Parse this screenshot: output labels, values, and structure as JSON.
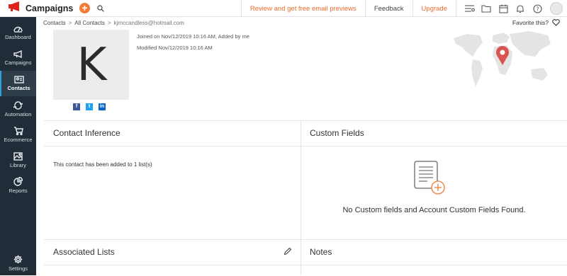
{
  "app": {
    "title": "Campaigns"
  },
  "topbar": {
    "review_link": "Review and get free email previews",
    "feedback": "Feedback",
    "upgrade": "Upgrade",
    "accent": "#ef6b2b"
  },
  "sidebar": {
    "items": [
      {
        "label": "Dashboard",
        "icon": "dashboard-icon"
      },
      {
        "label": "Campaigns",
        "icon": "megaphone-icon"
      },
      {
        "label": "Contacts",
        "icon": "contact-card-icon",
        "active": true
      },
      {
        "label": "Automation",
        "icon": "automation-icon"
      },
      {
        "label": "Ecommerce",
        "icon": "cart-icon"
      },
      {
        "label": "Library",
        "icon": "image-library-icon"
      },
      {
        "label": "Reports",
        "icon": "pie-chart-icon"
      },
      {
        "label": "Settings",
        "icon": "gear-icon"
      }
    ]
  },
  "breadcrumb": {
    "contacts": "Contacts",
    "all_contacts": "All Contacts",
    "email": "kjmccandless@hotmail.com",
    "favorite": "Favorite this?"
  },
  "contact": {
    "initial": "K",
    "joined": "Joined on Nov/12/2019 10:16 AM, Added by me",
    "modified": "Modified Nov/12/2019 10:16 AM"
  },
  "inference": {
    "title": "Contact Inference",
    "text": "This contact has been added to 1 list(s)"
  },
  "custom_fields": {
    "title": "Custom Fields",
    "empty": "No Custom fields and Account Custom Fields Found."
  },
  "associated_lists": {
    "title": "Associated Lists"
  },
  "notes": {
    "title": "Notes"
  }
}
